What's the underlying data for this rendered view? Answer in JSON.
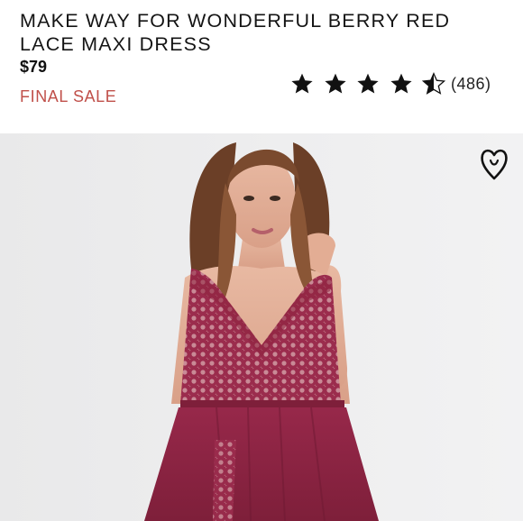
{
  "product": {
    "title": "MAKE WAY FOR WONDERFUL BERRY RED LACE MAXI DRESS",
    "price": "$79",
    "sale_label": "FINAL SALE",
    "rating": {
      "value": 4.5,
      "max": 5,
      "count_label": "(486)"
    }
  },
  "icons": {
    "favorite": "heart-outline-icon",
    "star_full": "star-icon",
    "star_half": "star-half-icon"
  },
  "colors": {
    "sale": "#c0504a",
    "dress": "#8e2540",
    "background": "#ebebec"
  }
}
